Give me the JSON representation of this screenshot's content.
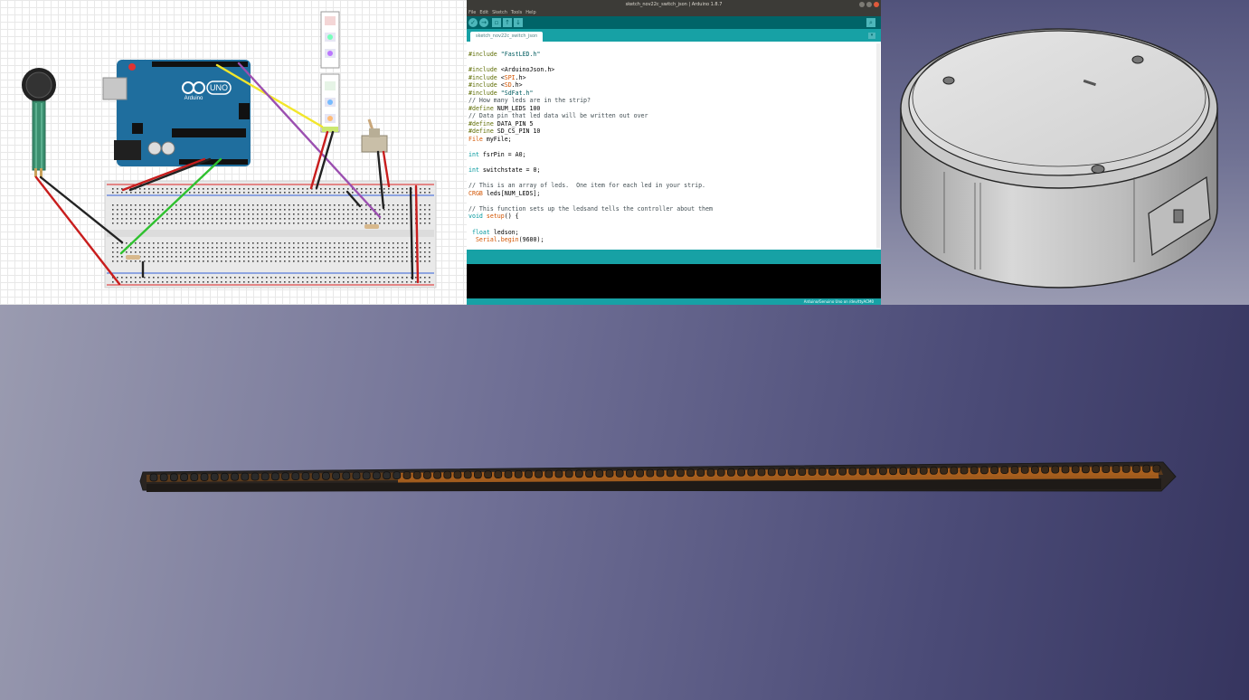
{
  "ide": {
    "window_title": "sketch_nov22c_switch_json | Arduino 1.8.7",
    "menu": [
      "File",
      "Edit",
      "Sketch",
      "Tools",
      "Help"
    ],
    "tab_label": "sketch_nov22c_switch_json",
    "footer_text": "Arduino/Genuino Uno on /dev/ttyACM0",
    "code_lines": [
      "#include \"FastLED.h\"",
      "",
      "#include <ArduinoJson.h>",
      "#include <SPI.h>",
      "#include <SD.h>",
      "#include \"SdFat.h\"",
      "// How many leds are in the strip?",
      "#define NUM_LEDS 100",
      "// Data pin that led data will be written out over",
      "#define DATA_PIN 5",
      "#define SD_CS_PIN 10",
      "File myFile;",
      "",
      "int fsrPin = A0;",
      "",
      "int switchstate = 0;",
      "",
      "// This is an array of leds.  One item for each led in your strip.",
      "CRGB leds[NUM_LEDS];",
      "",
      "// This function sets up the ledsand tells the controller about them",
      "void setup() {",
      "",
      " float ledson;",
      "  Serial.begin(9600);"
    ]
  },
  "fritzing": {
    "arduino_logo": "UNO",
    "arduino_brand": "Arduino"
  },
  "colors": {
    "ide_teal": "#17a1a5",
    "ide_dark_teal": "#006468",
    "arduino_blue": "#1f6e9e",
    "wire_red": "#c81d1d",
    "wire_black": "#222222",
    "wire_green": "#2fc12f",
    "wire_yellow": "#f2e62b",
    "wire_purple": "#9b4fb0",
    "strip_copper": "#b5651d"
  },
  "icons": {
    "verify": "check-icon",
    "upload": "arrow-right-icon",
    "new": "new-file-icon",
    "open": "arrow-up-icon",
    "save": "arrow-down-icon",
    "serial_monitor": "magnifier-icon"
  }
}
